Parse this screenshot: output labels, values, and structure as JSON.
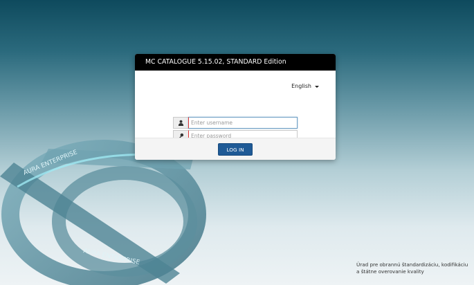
{
  "dialog": {
    "title": "MC CATALOGUE 5.15.02, STANDARD Edition",
    "language": "English",
    "username_placeholder": "Enter username",
    "password_placeholder": "Enter password",
    "login_label": "LOG IN"
  },
  "footer": {
    "line1": "Úrad pre obrannú štandardizáciu, kodifikáciu",
    "line2": "a štátne overovanie kvality"
  },
  "emblem": {
    "text_top": "AURA ENTERPRISE",
    "text_bottom": "AURA ENTERPRISE"
  },
  "colors": {
    "header_bg": "#000000",
    "button_bg": "#1f5a96",
    "accent_error": "#dd3333"
  },
  "icons": {
    "username": "user-icon",
    "password": "key-icon",
    "language": "caret-down-icon"
  }
}
